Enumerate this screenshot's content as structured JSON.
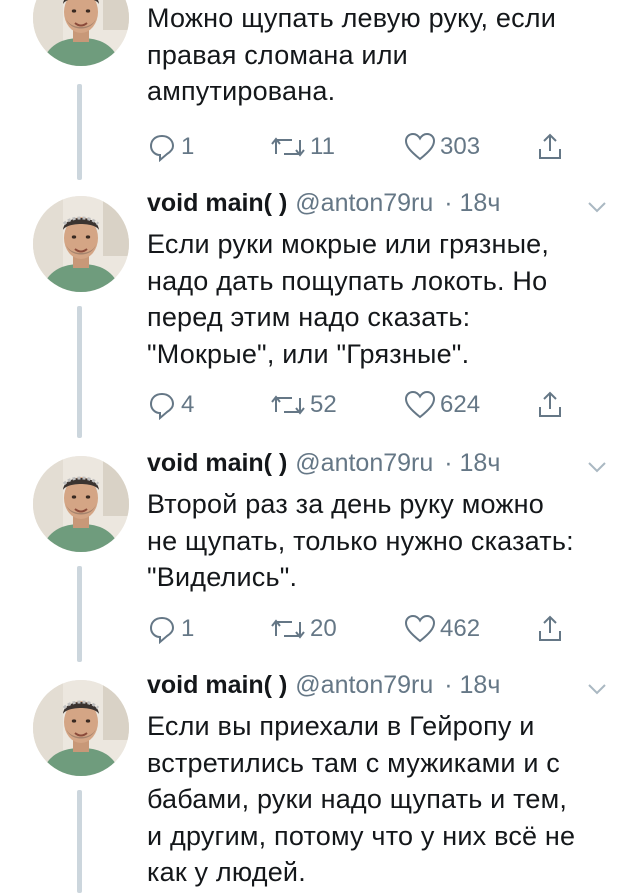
{
  "tweets": [
    {
      "name": "",
      "handle": "",
      "time": "",
      "text": "Можно щупать левую руку, если\nправая сломана или\nампутирована.",
      "replies": "1",
      "retweets": "11",
      "likes": "303"
    },
    {
      "name": "void main( )",
      "handle": "@anton79ru",
      "time": "· 18ч",
      "text": "Если руки мокрые или грязные,\nнадо дать пощупать локоть. Но\nперед этим надо сказать:\n\"Мокрые\", или \"Грязные\".",
      "replies": "4",
      "retweets": "52",
      "likes": "624"
    },
    {
      "name": "void main( )",
      "handle": "@anton79ru",
      "time": "· 18ч",
      "text": "Второй раз за день руку можно\nне щупать, только нужно сказать:\n\"Виделись\".",
      "replies": "1",
      "retweets": "20",
      "likes": "462"
    },
    {
      "name": "void main( )",
      "handle": "@anton79ru",
      "time": "· 18ч",
      "text": "Если вы приехали в Гейропу и\nвстретились там с мужиками и с\nбабами, руки надо щупать и тем,\nи другим, потому что у них всё не\nкак у людей."
    }
  ],
  "icons": {
    "reply": "reply-icon",
    "retweet": "retweet-icon",
    "like": "heart-icon",
    "share": "share-icon",
    "caret": "chevron-down-icon"
  },
  "colors": {
    "text": "#14171a",
    "meta": "#657786",
    "thread_line": "#ccd6dd"
  }
}
